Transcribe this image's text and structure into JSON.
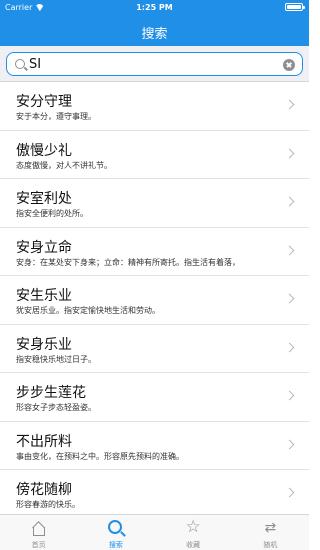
{
  "status_bar": {
    "carrier": "Carrier",
    "time": "1:25 PM"
  },
  "header": {
    "title": "搜索"
  },
  "search": {
    "value": "SI"
  },
  "results": [
    {
      "title": "安分守理",
      "desc": "安于本分，遵守事理。"
    },
    {
      "title": "傲慢少礼",
      "desc": "态度傲慢，对人不讲礼节。"
    },
    {
      "title": "安室利处",
      "desc": "指安全便利的处所。"
    },
    {
      "title": "安身立命",
      "desc": "安身：在某处安下身来；立命：精神有所寄托。指生活有着落，"
    },
    {
      "title": "安生乐业",
      "desc": "犹安居乐业。指安定愉快地生活和劳动。"
    },
    {
      "title": "安身乐业",
      "desc": "指安稳快乐地过日子。"
    },
    {
      "title": "步步生莲花",
      "desc": "形容女子步态轻盈姿。"
    },
    {
      "title": "不出所料",
      "desc": "事由变化，在预料之中。形容原先预料的准确。"
    },
    {
      "title": "傍花随柳",
      "desc": "形容春游的快乐。"
    }
  ],
  "tabbar": {
    "home": {
      "label": "首页",
      "icon": "home-icon"
    },
    "search": {
      "label": "搜索",
      "icon": "search-icon",
      "active": true
    },
    "favorites": {
      "label": "收藏",
      "icon": "star-icon"
    },
    "random": {
      "label": "随机",
      "icon": "shuffle-icon"
    }
  },
  "colors": {
    "accent": "#1f8fe8",
    "inactive": "#8e8e93"
  }
}
